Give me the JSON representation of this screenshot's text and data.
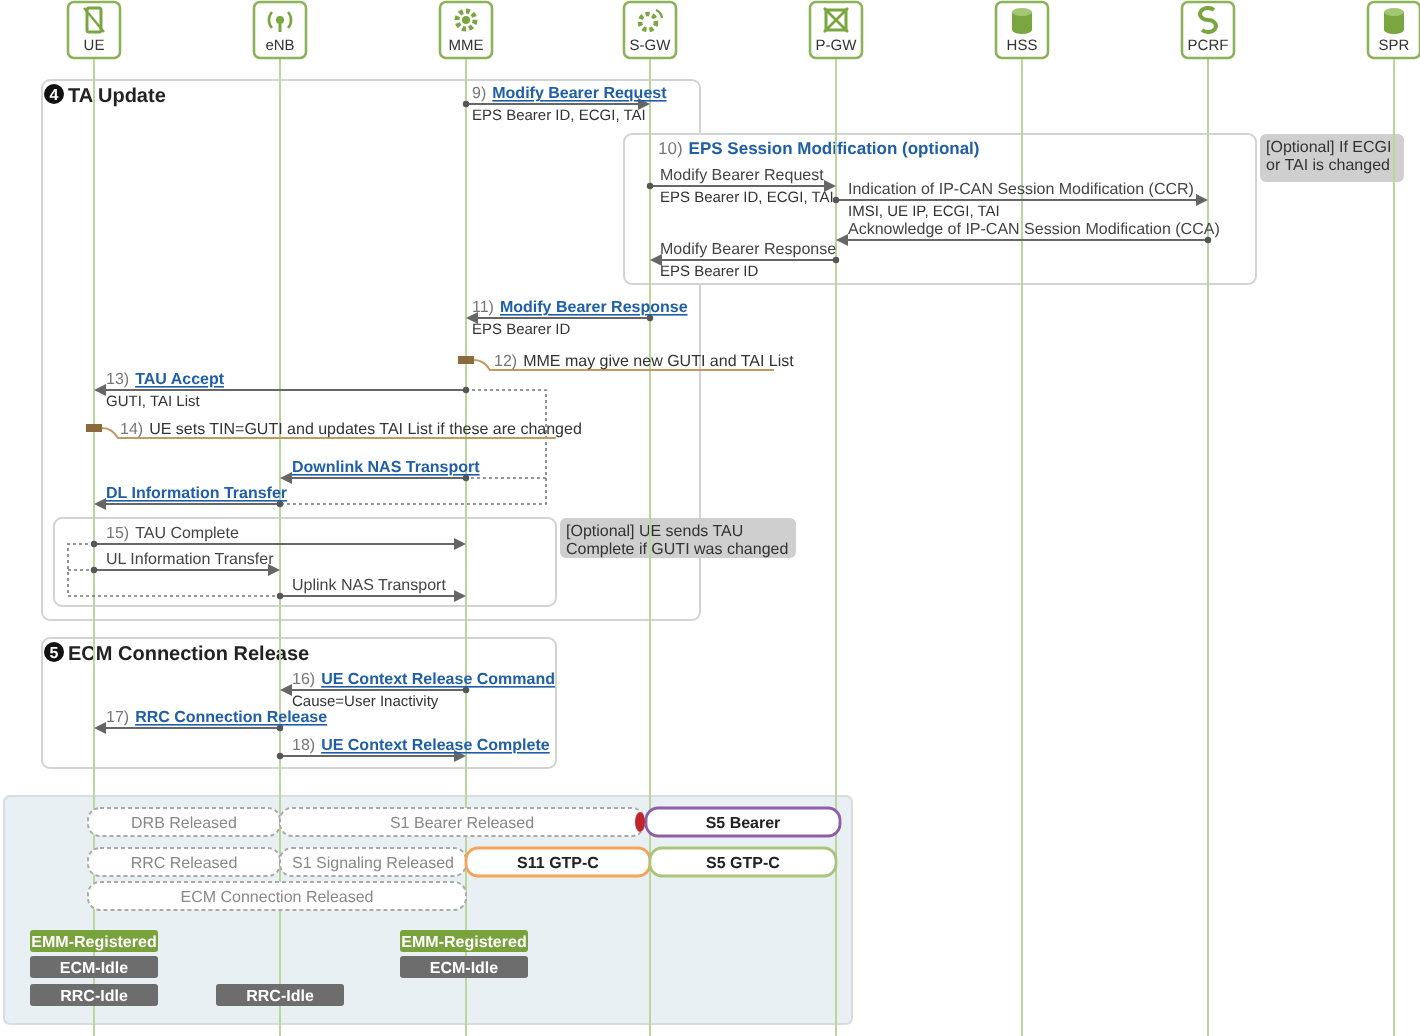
{
  "nodes": [
    {
      "label": "UE",
      "kind": "phone"
    },
    {
      "label": "eNB",
      "kind": "antenna"
    },
    {
      "label": "MME",
      "kind": "gear"
    },
    {
      "label": "S-GW",
      "kind": "gear-antenna"
    },
    {
      "label": "P-GW",
      "kind": "router"
    },
    {
      "label": "HSS",
      "kind": "database"
    },
    {
      "label": "PCRF",
      "kind": "swirl"
    },
    {
      "label": "SPR",
      "kind": "database"
    }
  ],
  "sections": [
    {
      "number": "4",
      "title": "TA Update"
    },
    {
      "number": "5",
      "title": "ECM Connection Release"
    }
  ],
  "session_group": {
    "step": "10)",
    "title": "EPS Session Modification (optional)"
  },
  "messages": [
    {
      "step": "9)",
      "label": "Modify Bearer Request",
      "detail": "EPS Bearer ID, ECGI, TAI",
      "kind": "procedure"
    },
    {
      "label": "Modify Bearer Request",
      "detail": "EPS Bearer ID, ECGI, TAI",
      "kind": "plain"
    },
    {
      "label": "Indication of IP-CAN Session Modification (CCR)",
      "detail": "IMSI, UE IP, ECGI, TAI",
      "kind": "plain"
    },
    {
      "label": "Acknowledge of IP-CAN Session Modification (CCA)",
      "kind": "plain"
    },
    {
      "label": "Modify Bearer Response",
      "detail": "EPS Bearer ID",
      "kind": "plain"
    },
    {
      "step": "11)",
      "label": "Modify Bearer Response",
      "detail": "EPS Bearer ID",
      "kind": "procedure"
    },
    {
      "step": "12)",
      "label": "MME may give new GUTI and TAI List",
      "kind": "action"
    },
    {
      "step": "13)",
      "label": "TAU Accept",
      "detail": "GUTI, TAI List",
      "kind": "procedure"
    },
    {
      "step": "14)",
      "label": "UE sets TIN=GUTI and updates TAI List if these are changed",
      "kind": "action"
    },
    {
      "label": "Downlink NAS Transport",
      "kind": "procedure"
    },
    {
      "label": "DL Information Transfer",
      "kind": "procedure"
    },
    {
      "step": "15)",
      "label": "TAU Complete",
      "kind": "plain"
    },
    {
      "label": "UL Information Transfer",
      "kind": "plain"
    },
    {
      "label": "Uplink NAS Transport",
      "kind": "plain"
    },
    {
      "step": "16)",
      "label": "UE Context Release Command",
      "detail": "Cause=User Inactivity",
      "kind": "procedure"
    },
    {
      "step": "17)",
      "label": "RRC Connection Release",
      "kind": "procedure"
    },
    {
      "step": "18)",
      "label": "UE Context Release Complete",
      "kind": "procedure"
    }
  ],
  "notes": [
    {
      "lines": [
        "[Optional] If ECGI",
        "or TAI is changed"
      ]
    },
    {
      "lines": [
        "[Optional] UE sends TAU",
        "Complete if GUTI was changed"
      ]
    }
  ],
  "bearers": [
    {
      "label": "DRB Released",
      "kind": "released"
    },
    {
      "label": "S1 Bearer Released",
      "kind": "released"
    },
    {
      "label": "S5 Bearer",
      "kind": "active",
      "color": "#8e5fa8"
    },
    {
      "label": "RRC  Released",
      "kind": "released"
    },
    {
      "label": "S1 Signaling Released",
      "kind": "released"
    },
    {
      "label": "S11 GTP-C",
      "kind": "active",
      "color": "#f5a35a"
    },
    {
      "label": "S5 GTP-C",
      "kind": "active",
      "color": "#a9c57c"
    },
    {
      "label": "ECM Connection Released",
      "kind": "released"
    }
  ],
  "states": [
    {
      "label": "EMM-Registered",
      "kind": "registered"
    },
    {
      "label": "ECM-Idle",
      "kind": "idle"
    },
    {
      "label": "RRC-Idle",
      "kind": "idle"
    },
    {
      "label": "RRC-Idle",
      "kind": "idle"
    },
    {
      "label": "EMM-Registered",
      "kind": "registered"
    },
    {
      "label": "ECM-Idle",
      "kind": "idle"
    }
  ]
}
